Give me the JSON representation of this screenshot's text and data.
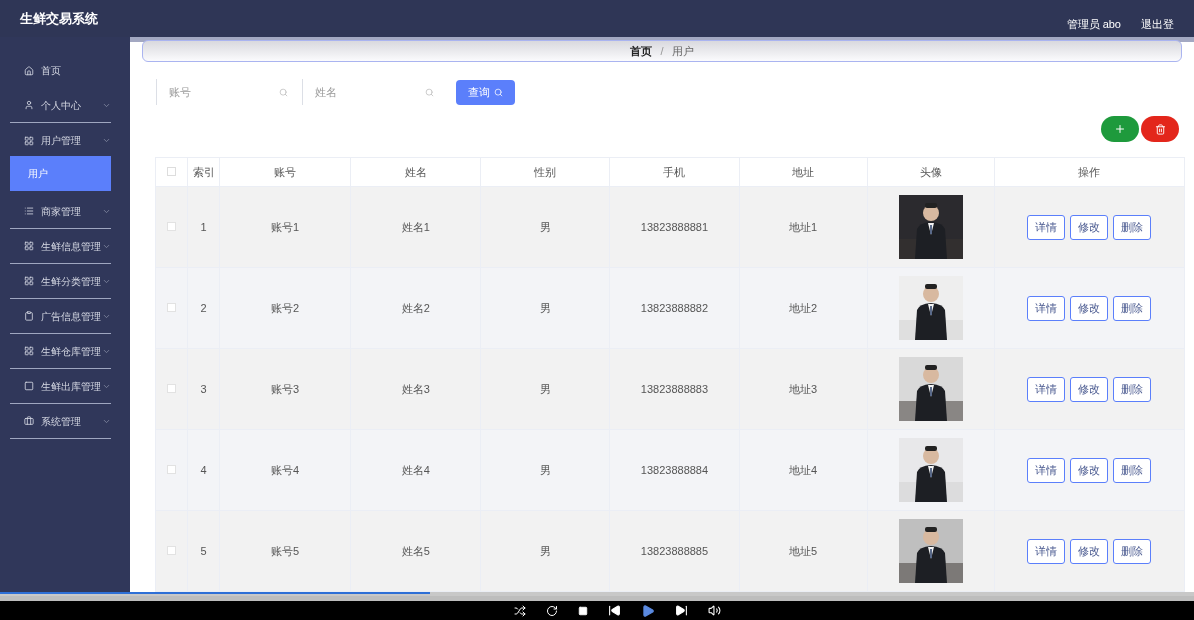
{
  "header": {
    "title": "生鲜交易系统",
    "user": "管理员 abo",
    "logout": "退出登"
  },
  "sidebar": {
    "items": [
      {
        "label": "首页",
        "selected": false
      },
      {
        "label": "个人中心",
        "selected": false
      },
      {
        "label": "用户管理",
        "selected": false
      },
      {
        "label": "用户",
        "selected": true
      },
      {
        "label": "商家管理",
        "selected": false
      },
      {
        "label": "生鲜信息管理",
        "selected": false
      },
      {
        "label": "生鲜分类管理",
        "selected": false
      },
      {
        "label": "广告信息管理",
        "selected": false
      },
      {
        "label": "生鲜仓库管理",
        "selected": false
      },
      {
        "label": "生鲜出库管理",
        "selected": false
      },
      {
        "label": "系统管理",
        "selected": false
      }
    ]
  },
  "breadcrumb": {
    "items": [
      "首页",
      "用户"
    ],
    "separator": "/"
  },
  "search": {
    "fields": [
      {
        "placeholder": "账号"
      },
      {
        "placeholder": "姓名"
      }
    ],
    "button": "查询"
  },
  "table": {
    "columns": [
      "索引",
      "账号",
      "姓名",
      "性别",
      "手机",
      "地址",
      "头像",
      "操作"
    ],
    "all_checked": false,
    "rows": [
      {
        "checked": false,
        "cells": [
          "1",
          "账号1",
          "姓名1",
          "男",
          "13823888881",
          "地址1"
        ],
        "actions": [
          "详情",
          "修改",
          "删除"
        ]
      },
      {
        "checked": false,
        "cells": [
          "2",
          "账号2",
          "姓名2",
          "男",
          "13823888882",
          "地址2"
        ],
        "actions": [
          "详情",
          "修改",
          "删除"
        ]
      },
      {
        "checked": false,
        "cells": [
          "3",
          "账号3",
          "姓名3",
          "男",
          "13823888883",
          "地址3"
        ],
        "actions": [
          "详情",
          "修改",
          "删除"
        ]
      },
      {
        "checked": false,
        "cells": [
          "4",
          "账号4",
          "姓名4",
          "男",
          "13823888884",
          "地址4"
        ],
        "actions": [
          "详情",
          "修改",
          "删除"
        ]
      },
      {
        "checked": false,
        "cells": [
          "5",
          "账号5",
          "姓名5",
          "男",
          "13823888885",
          "地址5"
        ],
        "actions": [
          "详情",
          "修改",
          "删除"
        ]
      }
    ]
  },
  "player": {
    "level": 0.36
  }
}
